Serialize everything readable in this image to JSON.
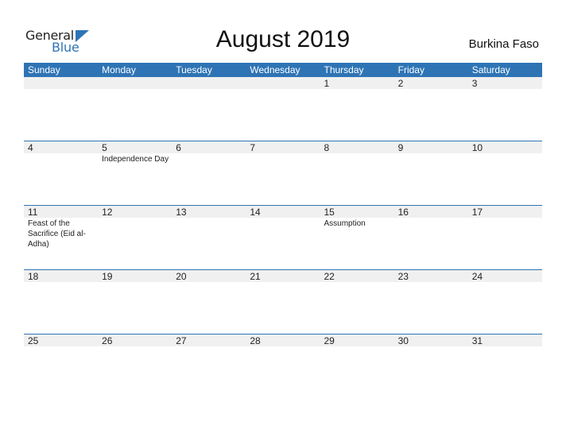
{
  "logo": {
    "general": "General",
    "blue": "Blue"
  },
  "title": "August 2019",
  "country": "Burkina Faso",
  "colors": {
    "accent": "#2e74b5",
    "date_strip": "#f0f0f0"
  },
  "weekdays": [
    "Sunday",
    "Monday",
    "Tuesday",
    "Wednesday",
    "Thursday",
    "Friday",
    "Saturday"
  ],
  "weeks": [
    {
      "days": [
        {
          "num": "",
          "event": ""
        },
        {
          "num": "",
          "event": ""
        },
        {
          "num": "",
          "event": ""
        },
        {
          "num": "",
          "event": ""
        },
        {
          "num": "1",
          "event": ""
        },
        {
          "num": "2",
          "event": ""
        },
        {
          "num": "3",
          "event": ""
        }
      ]
    },
    {
      "days": [
        {
          "num": "4",
          "event": ""
        },
        {
          "num": "5",
          "event": "Independence Day"
        },
        {
          "num": "6",
          "event": ""
        },
        {
          "num": "7",
          "event": ""
        },
        {
          "num": "8",
          "event": ""
        },
        {
          "num": "9",
          "event": ""
        },
        {
          "num": "10",
          "event": ""
        }
      ]
    },
    {
      "days": [
        {
          "num": "11",
          "event": "Feast of the Sacrifice (Eid al-Adha)"
        },
        {
          "num": "12",
          "event": ""
        },
        {
          "num": "13",
          "event": ""
        },
        {
          "num": "14",
          "event": ""
        },
        {
          "num": "15",
          "event": "Assumption"
        },
        {
          "num": "16",
          "event": ""
        },
        {
          "num": "17",
          "event": ""
        }
      ]
    },
    {
      "days": [
        {
          "num": "18",
          "event": ""
        },
        {
          "num": "19",
          "event": ""
        },
        {
          "num": "20",
          "event": ""
        },
        {
          "num": "21",
          "event": ""
        },
        {
          "num": "22",
          "event": ""
        },
        {
          "num": "23",
          "event": ""
        },
        {
          "num": "24",
          "event": ""
        }
      ]
    },
    {
      "days": [
        {
          "num": "25",
          "event": ""
        },
        {
          "num": "26",
          "event": ""
        },
        {
          "num": "27",
          "event": ""
        },
        {
          "num": "28",
          "event": ""
        },
        {
          "num": "29",
          "event": ""
        },
        {
          "num": "30",
          "event": ""
        },
        {
          "num": "31",
          "event": ""
        }
      ]
    }
  ]
}
